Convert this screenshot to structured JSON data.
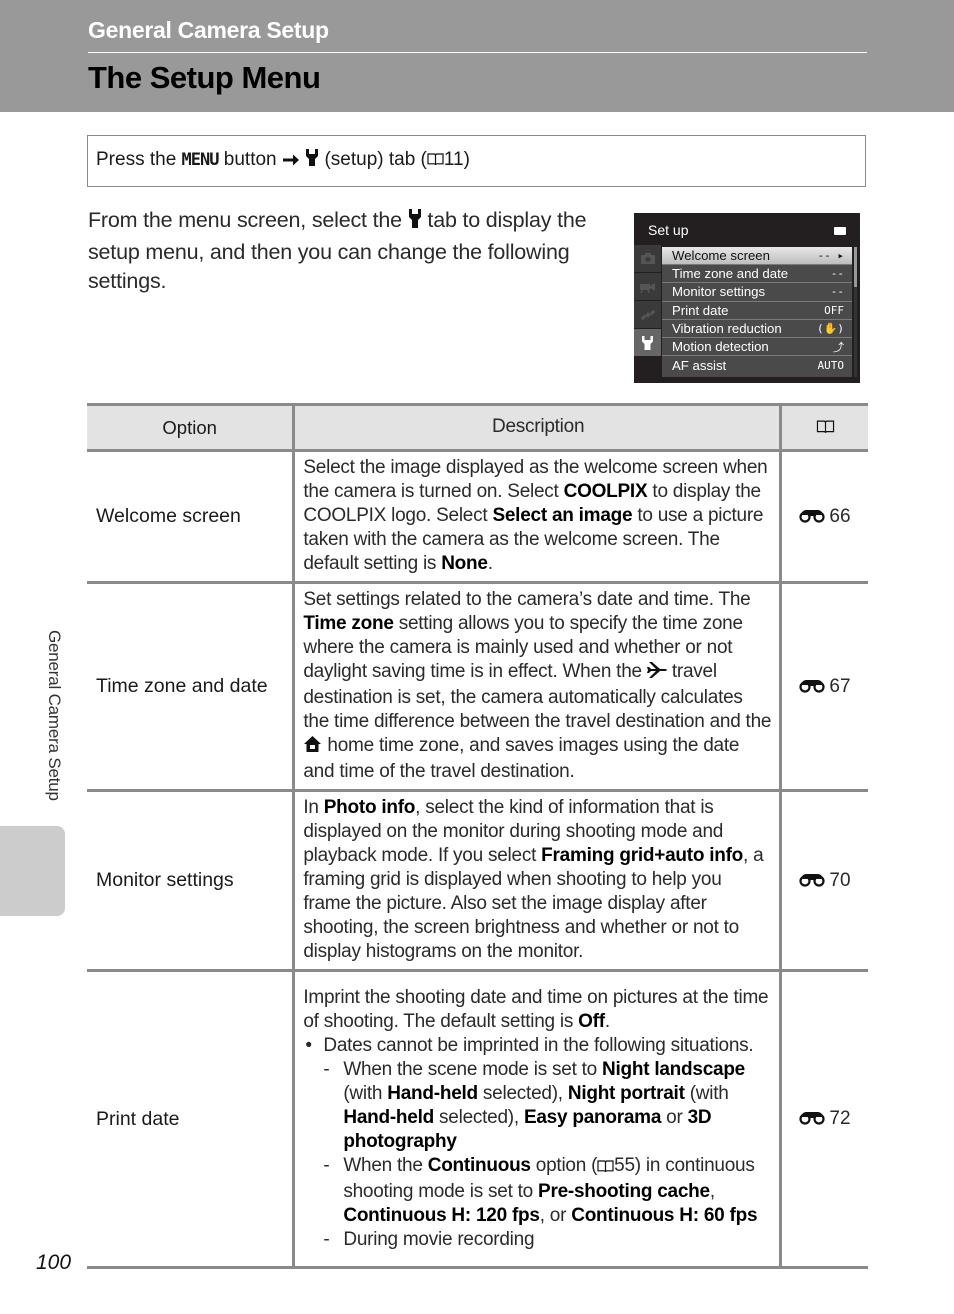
{
  "header": {
    "section_title": "General Camera Setup",
    "page_title": "The Setup Menu"
  },
  "navigation_box": {
    "prefix": "Press the",
    "menu_button": "MENU",
    "button_word": "button",
    "arrow_icon": "right-arrow-icon",
    "setup_icon": "wrench-icon",
    "tab_text": "(setup) tab (",
    "book_icon": "book-icon",
    "page_ref": "11",
    "suffix": ")"
  },
  "intro": {
    "part1": "From the menu screen, select the",
    "icon": "wrench-icon",
    "part2": "tab to display the setup menu, and then you can change the following settings."
  },
  "camera_screen": {
    "title": "Set up",
    "battery_icon": "battery-icon",
    "tabs": [
      {
        "icon": "camera-icon",
        "active": false
      },
      {
        "icon": "movie-camera-icon",
        "active": false
      },
      {
        "icon": "satellite-icon",
        "active": false
      },
      {
        "icon": "wrench-icon",
        "active": true
      }
    ],
    "items": [
      {
        "label": "Welcome screen",
        "value": "-- ▸",
        "selected": true
      },
      {
        "label": "Time zone and date",
        "value": "--",
        "selected": false
      },
      {
        "label": "Monitor settings",
        "value": "--",
        "selected": false
      },
      {
        "label": "Print date",
        "value": "OFF",
        "selected": false
      },
      {
        "label": "Vibration reduction",
        "value": "(✋)",
        "selected": false
      },
      {
        "label": "Motion detection",
        "value": "⤴",
        "selected": false
      },
      {
        "label": "AF assist",
        "value": "AUTO",
        "selected": false
      }
    ]
  },
  "table": {
    "headers": {
      "option": "Option",
      "description": "Description",
      "reference_icon": "book-icon"
    },
    "rows": [
      {
        "option": "Welcome screen",
        "description": [
          {
            "t": "Select the image displayed as the welcome screen when the camera is turned on. Select "
          },
          {
            "b": "COOLPIX"
          },
          {
            "t": " to display the COOLPIX logo. Select "
          },
          {
            "b": "Select an image"
          },
          {
            "t": " to use a picture taken with the camera as the welcome screen. The default setting is "
          },
          {
            "b": "None"
          },
          {
            "t": "."
          }
        ],
        "ref_icon": "binoculars-icon",
        "ref": "66"
      },
      {
        "option": "Time zone and date",
        "description": [
          {
            "t": "Set settings related to the camera’s date and time. The "
          },
          {
            "b": "Time zone"
          },
          {
            "t": " setting allows you to specify the time zone where the camera is mainly used and whether or not daylight saving time is in effect. When the "
          },
          {
            "icon": "airplane-icon",
            "glyph": "✈"
          },
          {
            "t": " travel destination is set, the camera automatically calculates the time difference between the travel destination and the "
          },
          {
            "icon": "home-icon",
            "glyph": "⌂"
          },
          {
            "t": " home time zone, and saves images using the date and time of the travel destination."
          }
        ],
        "ref_icon": "binoculars-icon",
        "ref": "67"
      },
      {
        "option": "Monitor settings",
        "description": [
          {
            "t": "In "
          },
          {
            "b": "Photo info"
          },
          {
            "t": ", select the kind of information that is displayed on the monitor during shooting mode and playback mode. If you select "
          },
          {
            "b": "Framing grid+auto info"
          },
          {
            "t": ", a framing grid is displayed when shooting to help you frame the picture. Also set the image display after shooting, the screen brightness and whether or not to display histograms on the monitor."
          }
        ],
        "ref_icon": "binoculars-icon",
        "ref": "70"
      },
      {
        "option": "Print date",
        "description": [
          {
            "t": "Imprint the shooting date and time on pictures at the time of shooting. The default setting is "
          },
          {
            "b": "Off"
          },
          {
            "t": "."
          }
        ],
        "bullet": "Dates cannot be imprinted in the following situations.",
        "sub_items": [
          [
            {
              "t": "When the scene mode is set to "
            },
            {
              "b": "Night landscape"
            },
            {
              "t": " (with "
            },
            {
              "b": "Hand-held"
            },
            {
              "t": " selected), "
            },
            {
              "b": "Night portrait"
            },
            {
              "t": " (with "
            },
            {
              "b": "Hand-held"
            },
            {
              "t": " selected), "
            },
            {
              "b": "Easy panorama"
            },
            {
              "t": " or "
            },
            {
              "b": "3D photography"
            }
          ],
          [
            {
              "t": "When the "
            },
            {
              "b": "Continuous"
            },
            {
              "t": " option ("
            },
            {
              "icon": "book-icon",
              "glyph": "book"
            },
            {
              "t": "55) in continuous shooting mode is set to "
            },
            {
              "b": "Pre-shooting cache"
            },
            {
              "t": ", "
            },
            {
              "b": "Continuous H: 120 fps"
            },
            {
              "t": ", or "
            },
            {
              "b": "Continuous H: 60 fps"
            }
          ],
          [
            {
              "t": "During movie recording"
            }
          ]
        ],
        "ref_icon": "binoculars-icon",
        "ref": "72"
      }
    ]
  },
  "side_tab": {
    "label": "General Camera Setup"
  },
  "footer": {
    "page_number": "100"
  }
}
